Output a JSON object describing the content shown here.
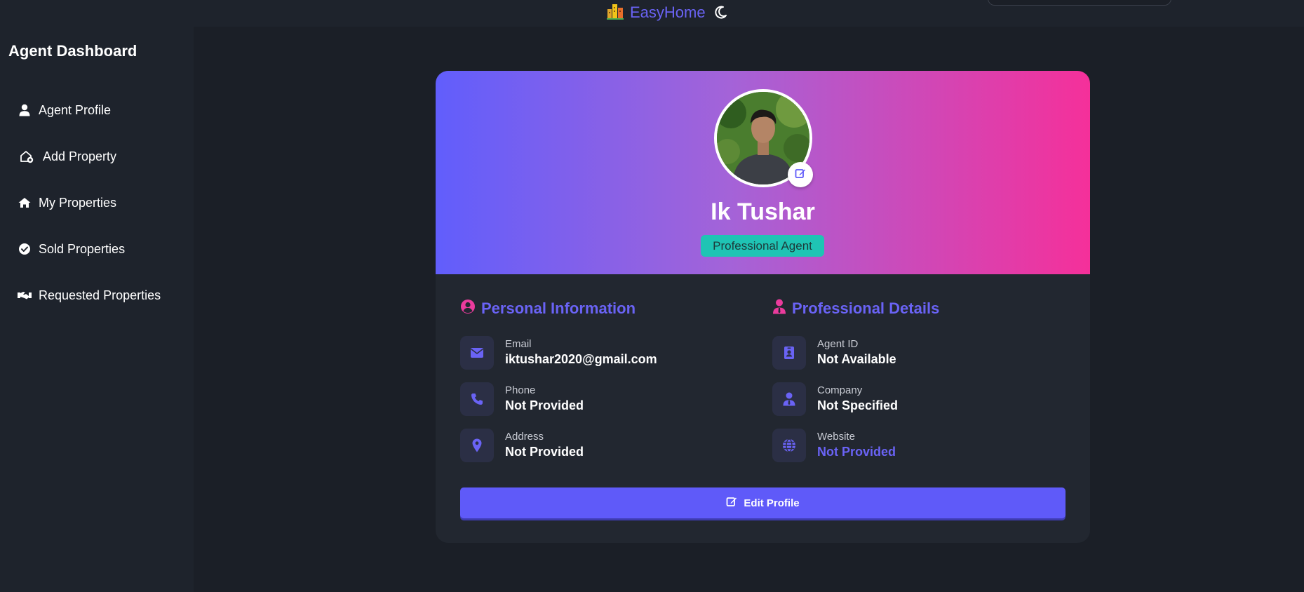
{
  "header": {
    "brand_name": "EasyHome",
    "brand_icon": "buildings-icon",
    "theme_icon": "moon-icon"
  },
  "sidebar": {
    "title": "Agent Dashboard",
    "items": [
      {
        "label": "Agent Profile",
        "icon": "user-icon"
      },
      {
        "label": "Add Property",
        "icon": "house-plus-icon"
      },
      {
        "label": "My Properties",
        "icon": "home-icon"
      },
      {
        "label": "Sold Properties",
        "icon": "check-circle-icon"
      },
      {
        "label": "Requested Properties",
        "icon": "handshake-icon"
      }
    ]
  },
  "profile": {
    "name": "Ik Tushar",
    "role": "Professional Agent"
  },
  "personal": {
    "title": "Personal Information",
    "items": [
      {
        "label": "Email",
        "value": "iktushar2020@gmail.com",
        "icon": "envelope-icon"
      },
      {
        "label": "Phone",
        "value": "Not Provided",
        "icon": "phone-icon"
      },
      {
        "label": "Address",
        "value": "Not Provided",
        "icon": "map-pin-icon"
      }
    ]
  },
  "professional": {
    "title": "Professional Details",
    "items": [
      {
        "label": "Agent ID",
        "value": "Not Available",
        "icon": "id-badge-icon"
      },
      {
        "label": "Company",
        "value": "Not Specified",
        "icon": "user-tie-icon"
      },
      {
        "label": "Website",
        "value": "Not Provided",
        "icon": "globe-icon"
      }
    ]
  },
  "actions": {
    "edit_profile": "Edit Profile"
  },
  "colors": {
    "accent": "#5f5af9",
    "badge": "#1fc4b4",
    "gradient_start": "#615efc",
    "gradient_end": "#f5309a"
  }
}
